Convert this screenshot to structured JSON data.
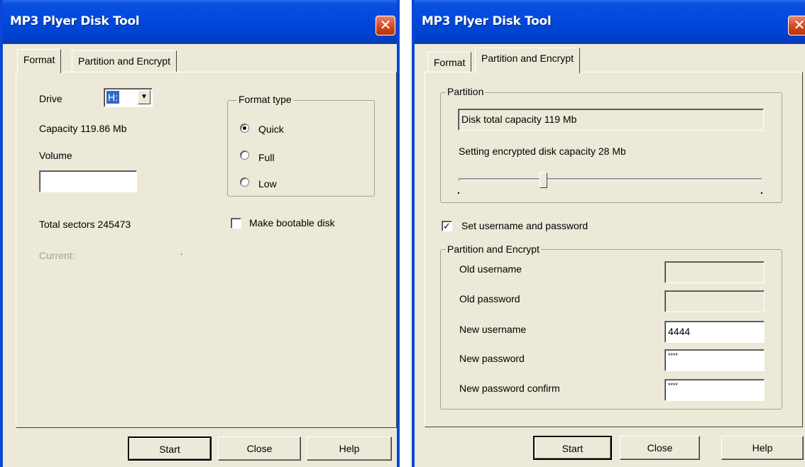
{
  "left_window": {
    "title": "MP3 Plyer Disk Tool",
    "close_glyph": "✕",
    "tabs": [
      {
        "label": "Format",
        "active": true
      },
      {
        "label": "Partition and Encrypt",
        "active": false
      }
    ],
    "drive": {
      "label": "Drive",
      "value": "H:",
      "arrow": "▼"
    },
    "capacity": "Capacity 119.86 Mb",
    "volume": {
      "label": "Volume",
      "value": ""
    },
    "format_type": {
      "title": "Format type",
      "options": [
        {
          "label": "Quick",
          "selected": true
        },
        {
          "label": "Full",
          "selected": false
        },
        {
          "label": "Low",
          "selected": false
        }
      ]
    },
    "total_sectors": "Total sectors 245473",
    "make_bootable": {
      "label": "Make bootable disk",
      "checked": false
    },
    "current": {
      "label": "Current:",
      "value": "."
    },
    "buttons": {
      "start": "Start",
      "close": "Close",
      "help": "Help"
    }
  },
  "right_window": {
    "title": "MP3 Plyer Disk Tool",
    "close_glyph": "✕",
    "tabs": [
      {
        "label": "Format",
        "active": false
      },
      {
        "label": "Partition and Encrypt",
        "active": true
      }
    ],
    "partition": {
      "title": "Partition",
      "total_capacity": "Disk total capacity 119 Mb",
      "encrypted_capacity_text": "Setting encrypted disk capacity 28 Mb",
      "slider_fraction": 0.28
    },
    "set_credentials": {
      "label": "Set username and password",
      "checked": true,
      "check_glyph": "✓"
    },
    "encrypt_group": {
      "title": "Partition and Encrypt",
      "fields": [
        {
          "label": "Old username",
          "value": "",
          "enabled": false
        },
        {
          "label": "Old password",
          "value": "",
          "enabled": false
        },
        {
          "label": "New username",
          "value": "4444",
          "enabled": true
        },
        {
          "label": "New password",
          "value": "****",
          "enabled": true
        },
        {
          "label": "New password confirm",
          "value": "****",
          "enabled": true
        }
      ]
    },
    "buttons": {
      "start": "Start",
      "close": "Close",
      "help": "Help"
    }
  },
  "colors": {
    "title_bar": "#0048dc",
    "dialog_bg": "#ece9d8",
    "close_button": "#d2451c",
    "selection": "#316ac5"
  }
}
